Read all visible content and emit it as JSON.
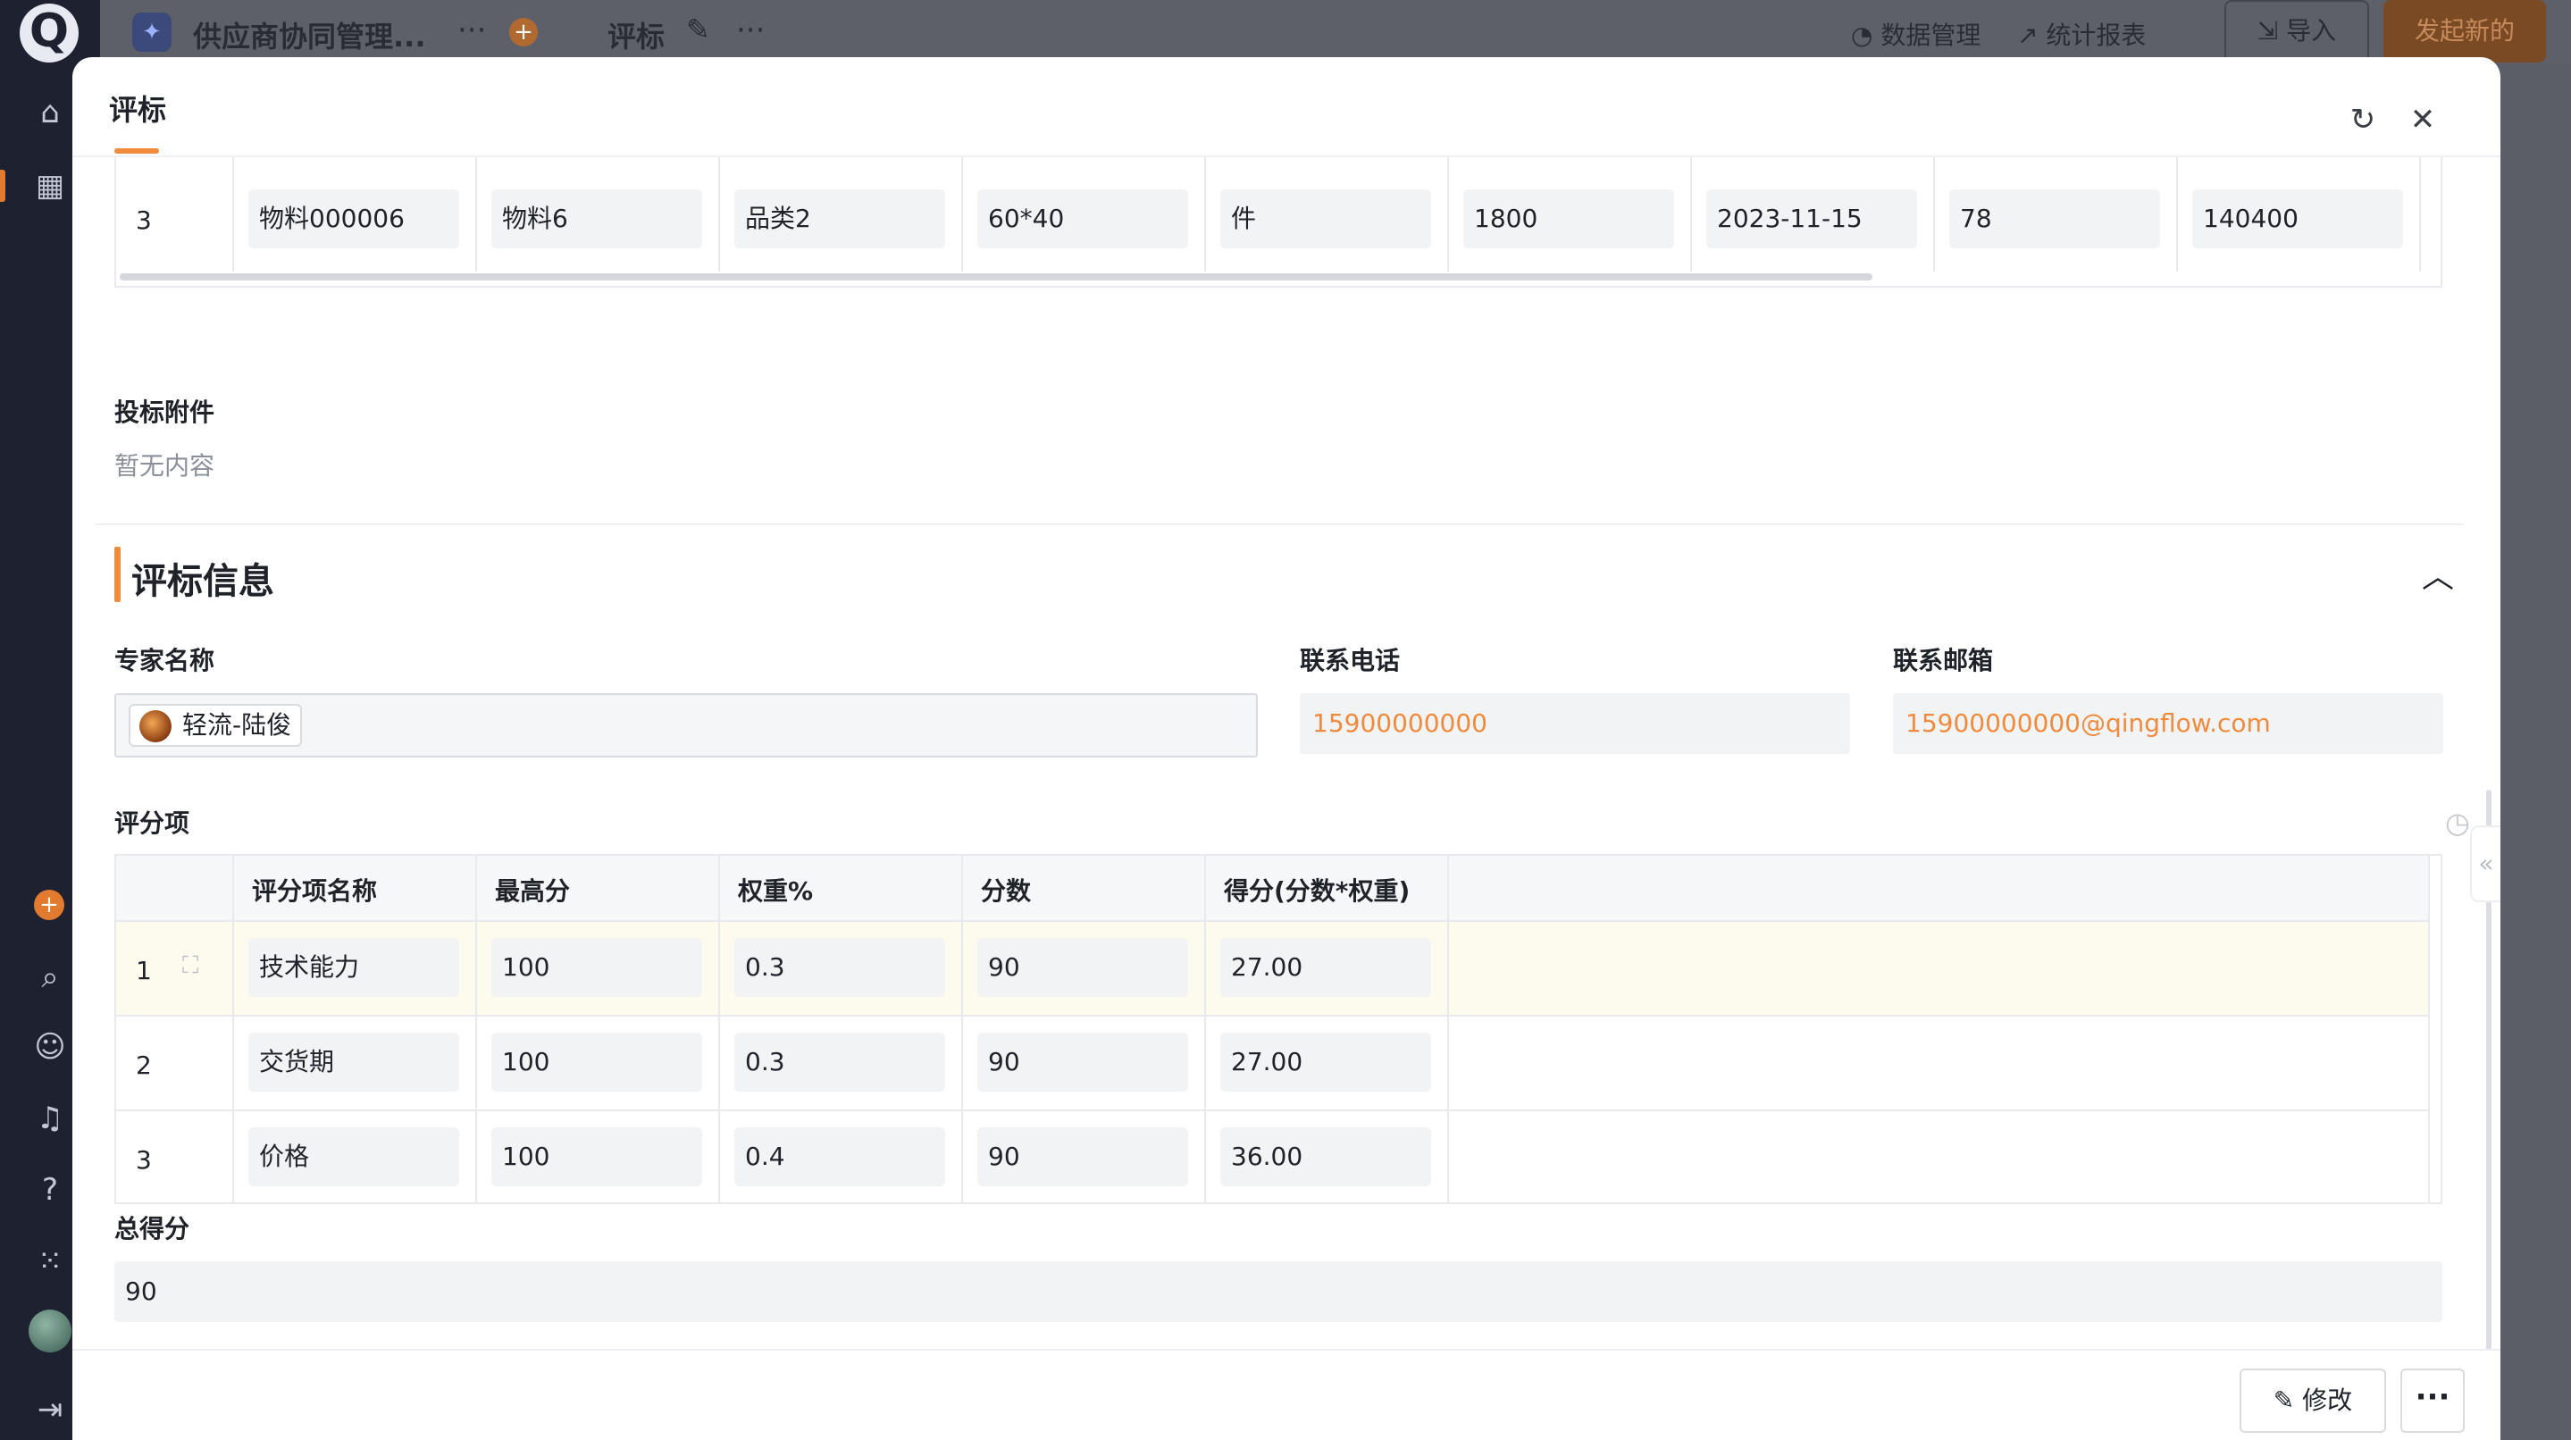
{
  "app": {
    "logo_letter": "Q",
    "name": "供应商协同管理...",
    "current_tab": "评标",
    "data_manage_label": "数据管理",
    "report_label": "统计报表",
    "import_label": "导入",
    "new_label": "发起新的"
  },
  "modal": {
    "title": "评标"
  },
  "product_table": {
    "row": {
      "no": "3",
      "cells": [
        "物料000006",
        "物料6",
        "品类2",
        "60*40",
        "件",
        "1800",
        "2023-11-15",
        "78",
        "140400"
      ]
    }
  },
  "attachment": {
    "label": "投标附件",
    "empty_text": "暂无内容"
  },
  "evaluation": {
    "section_title": "评标信息",
    "expert_label": "专家名称",
    "expert_name": "轻流-陆俊",
    "phone_label": "联系电话",
    "phone": "15900000000",
    "email_label": "联系邮箱",
    "email": "15900000000@qingflow.com",
    "score_items_label": "评分项",
    "score_table": {
      "headers": [
        "评分项名称",
        "最高分",
        "权重%",
        "分数",
        "得分(分数*权重)"
      ],
      "rows": [
        {
          "no": "1",
          "name": "技术能力",
          "max": "100",
          "weight": "0.3",
          "score": "90",
          "result": "27.00"
        },
        {
          "no": "2",
          "name": "交货期",
          "max": "100",
          "weight": "0.3",
          "score": "90",
          "result": "27.00"
        },
        {
          "no": "3",
          "name": "价格",
          "max": "100",
          "weight": "0.4",
          "score": "90",
          "result": "36.00"
        }
      ]
    },
    "total_label": "总得分",
    "total": "90"
  },
  "footer": {
    "edit_label": "修改",
    "more_label": "···"
  },
  "colors": {
    "accent": "#f08a3c",
    "highlight_row": "#fdfbee"
  }
}
